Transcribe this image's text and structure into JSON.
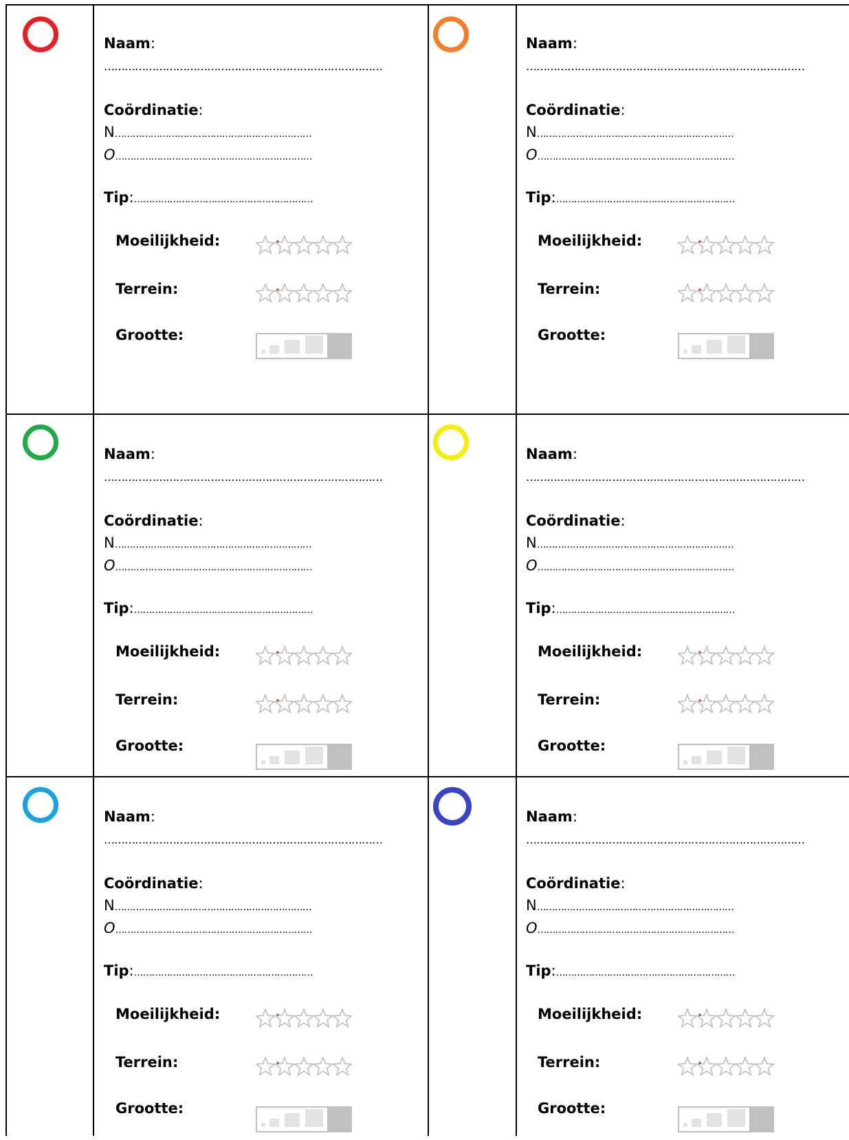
{
  "cards": [
    {
      "ring_color": "#e81e25"
    },
    {
      "ring_color": "#f47d28"
    },
    {
      "ring_color": "#22aa48"
    },
    {
      "ring_color": "#f5ee0a"
    },
    {
      "ring_color": "#1aa3e2"
    },
    {
      "ring_color": "#3843c6"
    }
  ],
  "labels": {
    "naam": "Naam",
    "colon": ":",
    "naam_line": "………………………………………………………………………",
    "coordinatie": "Coördinatie",
    "north_prefix": "N",
    "east_prefix": "O",
    "coord_line": "…………………………………………………………",
    "tip": "Tip",
    "tip_line": "……………………………………………………",
    "moeilijkheid": "Moeilijkheid:",
    "terrein": "Terrein:",
    "grootte": "Grootte:"
  },
  "ratings": {
    "moeilijkheid_stars": 0.5,
    "terrein_stars": 0.5,
    "max_stars": 5
  },
  "colors": {
    "star_outline": "#bdbdbd",
    "star_dot": "#d24a3a",
    "size_active": "#bfbfbf",
    "size_inactive": "#e3e3e3"
  }
}
